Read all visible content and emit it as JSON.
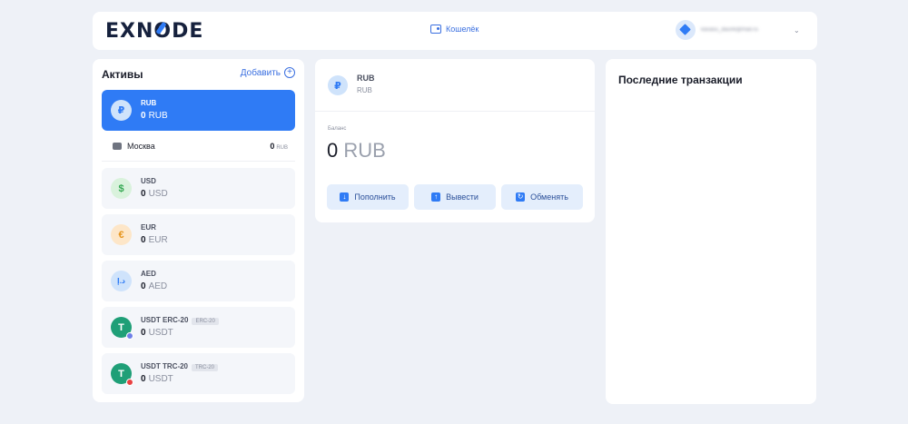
{
  "header": {
    "logo_pre": "EXN",
    "logo_o": "O",
    "logo_post": "DE",
    "nav_wallet": "Кошелёк",
    "user_email": "kasasu_daurik@mail.ru"
  },
  "assets": {
    "title": "Активы",
    "add_label": "Добавить",
    "items": [
      {
        "name": "RUB",
        "amount": "0",
        "unit": "RUB",
        "symbol": "₽",
        "color": "#cfe3fb",
        "fg": "#2f7bf5"
      },
      {
        "name": "USD",
        "amount": "0",
        "unit": "USD",
        "symbol": "$",
        "color": "#d9f2dc",
        "fg": "#33a852"
      },
      {
        "name": "EUR",
        "amount": "0",
        "unit": "EUR",
        "symbol": "€",
        "color": "#fde6c8",
        "fg": "#e6951e"
      },
      {
        "name": "AED",
        "amount": "0",
        "unit": "AED",
        "symbol": "د.إ",
        "color": "#cfe3fb",
        "fg": "#2f7bf5"
      },
      {
        "name": "USDT ERC-20",
        "tag": "ERC-20",
        "amount": "0",
        "unit": "USDT",
        "symbol": "T",
        "color": "#1f9f77",
        "fg": "#ffffff",
        "badge": "#6f7fe8"
      },
      {
        "name": "USDT TRC-20",
        "tag": "TRC-20",
        "amount": "0",
        "unit": "USDT",
        "symbol": "T",
        "color": "#1f9f77",
        "fg": "#ffffff",
        "badge": "#e84142"
      }
    ],
    "sub_item": {
      "name": "Москва",
      "amount": "0",
      "unit": "RUB"
    }
  },
  "detail": {
    "name": "RUB",
    "sub": "RUB",
    "symbol": "₽",
    "balance_label": "Баланс",
    "balance_amount": "0",
    "balance_unit": "RUB",
    "buttons": {
      "deposit": "Пополнить",
      "withdraw": "Вывести",
      "exchange": "Обменять"
    }
  },
  "transactions": {
    "title": "Последние транзакции"
  }
}
